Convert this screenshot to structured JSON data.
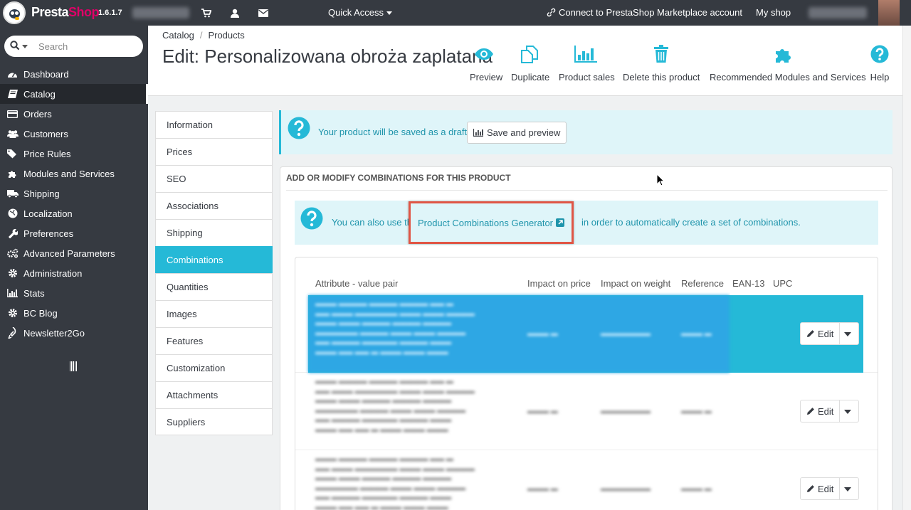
{
  "topbar": {
    "brand_presta": "Presta",
    "brand_shop": "Shop",
    "version": "1.6.1.7",
    "quick_access": "Quick Access",
    "connect": "Connect to PrestaShop Marketplace account",
    "my_shop": "My shop"
  },
  "sidebar": {
    "search_placeholder": "Search",
    "items": [
      {
        "label": "Dashboard",
        "icon": "dashboard-icon"
      },
      {
        "label": "Catalog",
        "icon": "book-icon"
      },
      {
        "label": "Orders",
        "icon": "credit-card-icon"
      },
      {
        "label": "Customers",
        "icon": "users-icon"
      },
      {
        "label": "Price Rules",
        "icon": "tags-icon"
      },
      {
        "label": "Modules and Services",
        "icon": "puzzle-icon"
      },
      {
        "label": "Shipping",
        "icon": "truck-icon"
      },
      {
        "label": "Localization",
        "icon": "globe-icon"
      },
      {
        "label": "Preferences",
        "icon": "wrench-icon"
      },
      {
        "label": "Advanced Parameters",
        "icon": "cogs-icon"
      },
      {
        "label": "Administration",
        "icon": "cog-icon"
      },
      {
        "label": "Stats",
        "icon": "bar-chart-icon"
      },
      {
        "label": "BC Blog",
        "icon": "cog-icon"
      },
      {
        "label": "Newsletter2Go",
        "icon": "rocket-icon"
      }
    ],
    "active_index": 1
  },
  "header": {
    "breadcrumb": [
      "Catalog",
      "Products"
    ],
    "breadcrumb_sep": "/",
    "title": "Edit: Personalizowana obroża zaplatana",
    "toolbar": [
      {
        "label": "Preview",
        "icon": "eye-icon"
      },
      {
        "label": "Duplicate",
        "icon": "copy-icon"
      },
      {
        "label": "Product sales",
        "icon": "bar-chart-icon"
      },
      {
        "label": "Delete this product",
        "icon": "trash-icon"
      },
      {
        "label": "Recommended Modules and Services",
        "icon": "puzzle-icon"
      },
      {
        "label": "Help",
        "icon": "help-icon"
      }
    ]
  },
  "tabs": [
    "Information",
    "Prices",
    "SEO",
    "Associations",
    "Shipping",
    "Combinations",
    "Quantities",
    "Images",
    "Features",
    "Customization",
    "Attachments",
    "Suppliers"
  ],
  "active_tab": "Combinations",
  "draft": {
    "message": "Your product will be saved as a draft.",
    "button": "Save and preview"
  },
  "combinations": {
    "heading": "ADD OR MODIFY COMBINATIONS FOR THIS PRODUCT",
    "info_before": "You can also use the",
    "info_link": "Product Combinations Generator",
    "info_after": "in order to automatically create a set of combinations.",
    "columns": [
      "Attribute - value pair",
      "Impact on price",
      "Impact on weight",
      "Reference",
      "EAN-13",
      "UPC"
    ],
    "edit_label": "Edit"
  },
  "colors": {
    "accent": "#25b9d7",
    "sidebar_bg": "#363a41",
    "highlight_border": "#e05545",
    "info_bg": "#dff5f9",
    "info_text": "#1e94ab"
  }
}
